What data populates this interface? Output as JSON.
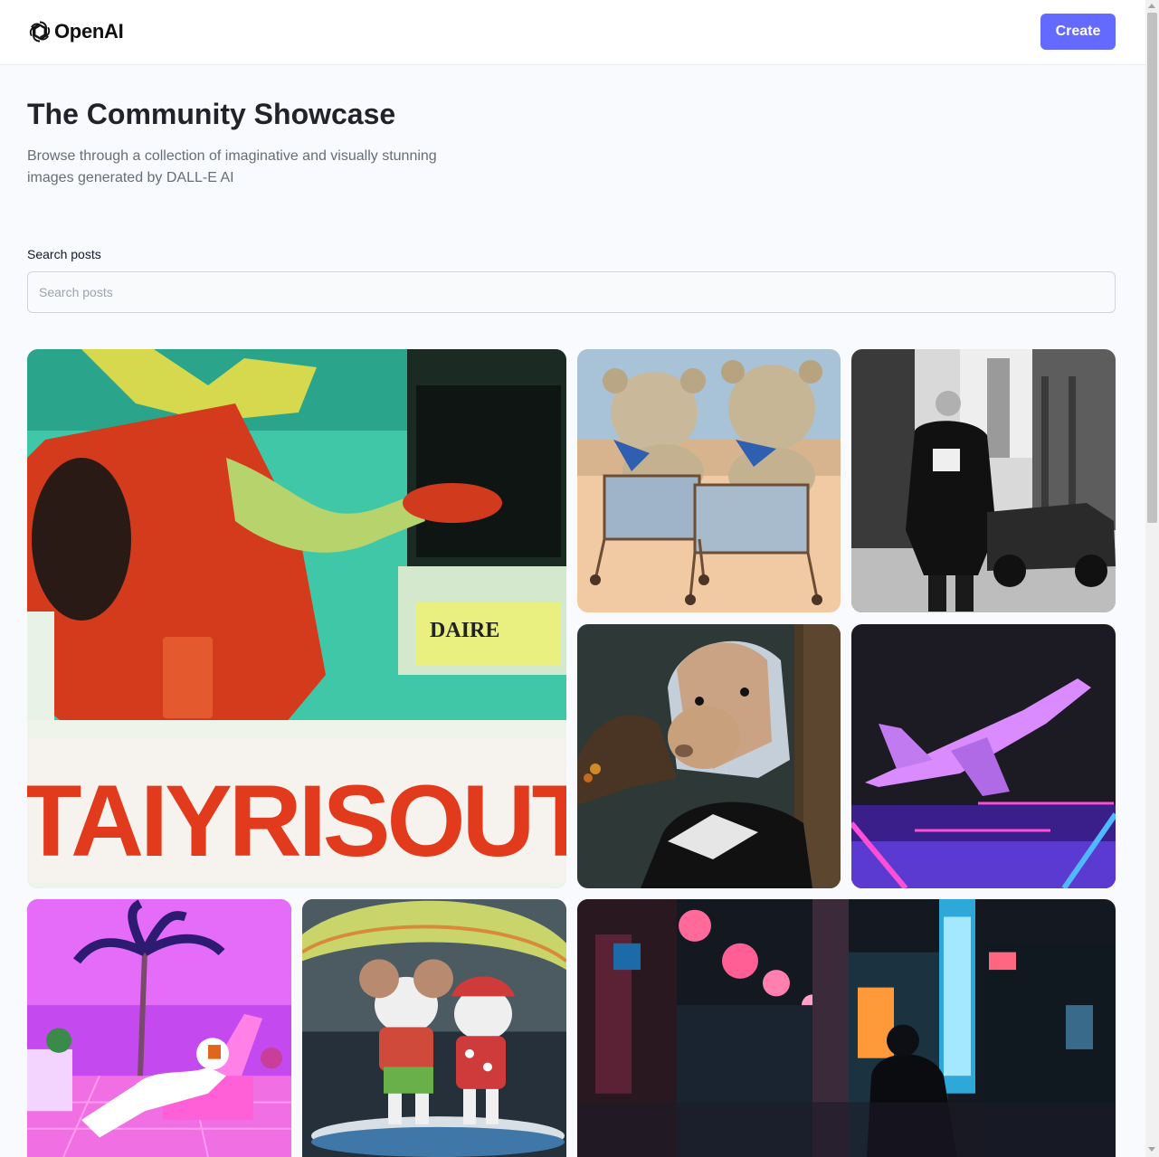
{
  "header": {
    "brand": "OpenAI",
    "logo_icon": "openai-logo-icon",
    "create_label": "Create",
    "accent_color": "#6469ff"
  },
  "main": {
    "title": "The Community Showcase",
    "subtitle": "Browse through a collection of imaginative and visually stunning images generated by DALL-E AI"
  },
  "search": {
    "label": "Search posts",
    "placeholder": "Search posts",
    "value": ""
  },
  "gallery": {
    "cards": [
      {
        "id": "card-1",
        "sign_text": "TAIYRISOUT",
        "small_sign": "DAIRE"
      },
      {
        "id": "card-2"
      },
      {
        "id": "card-3"
      },
      {
        "id": "card-4"
      },
      {
        "id": "card-5"
      },
      {
        "id": "card-6"
      },
      {
        "id": "card-7"
      },
      {
        "id": "card-8"
      }
    ]
  }
}
